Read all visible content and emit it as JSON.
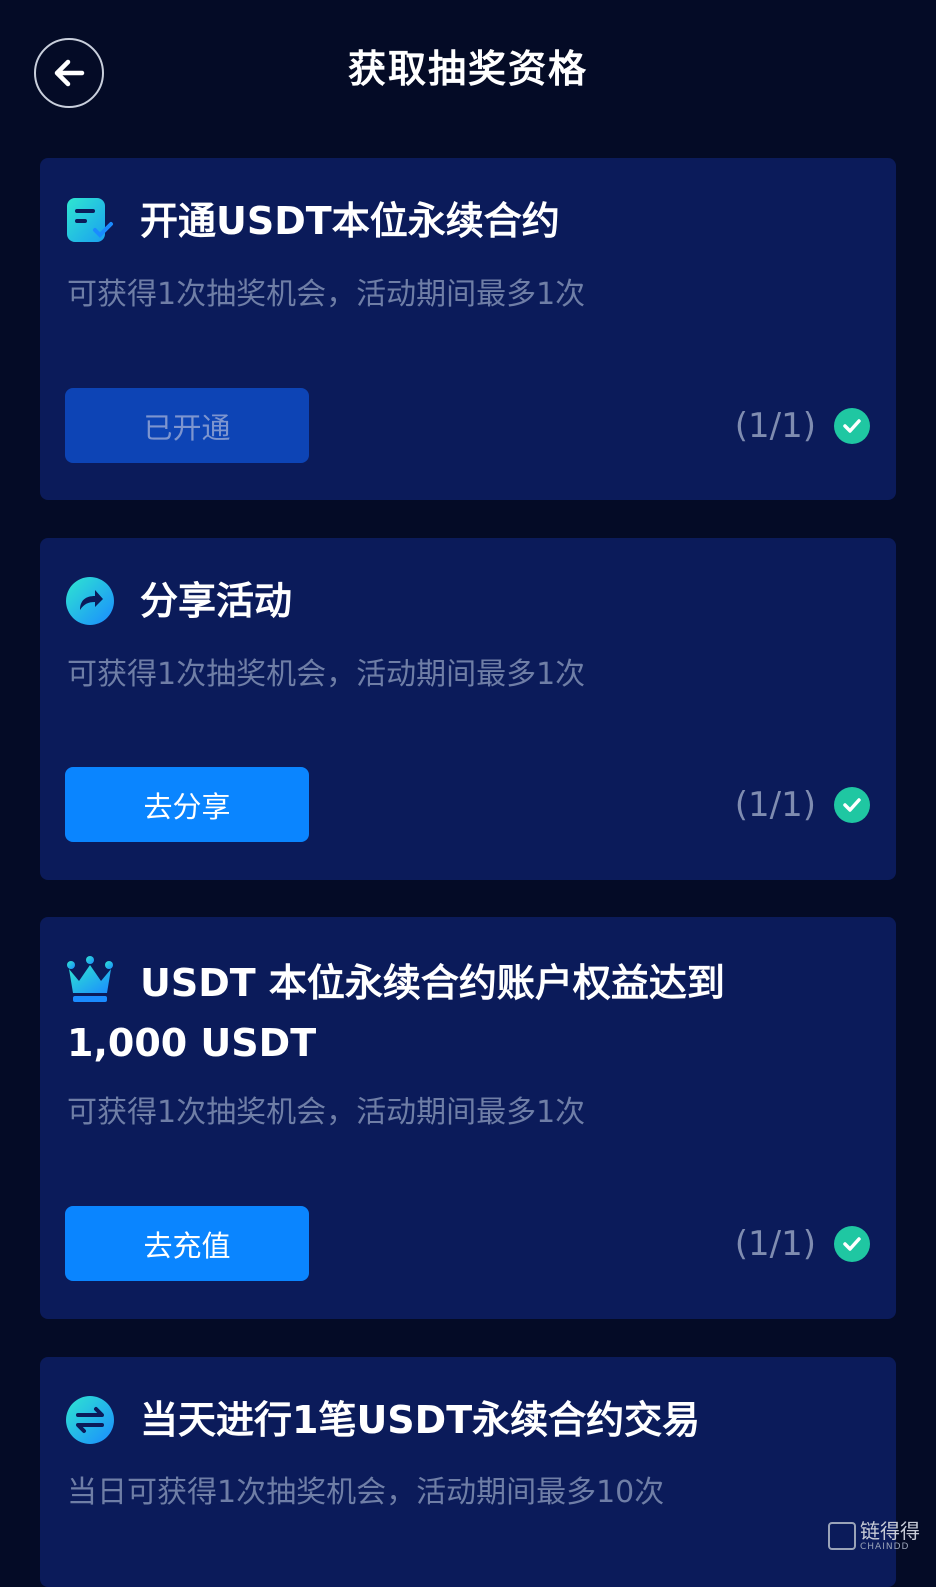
{
  "header": {
    "title": "获取抽奖资格"
  },
  "tasks": [
    {
      "title": "开通USDT本位永续合约",
      "desc": "可获得1次抽奖机会，活动期间最多1次",
      "button": "已开通",
      "progress": "(1/1)",
      "icon": "contract-check-icon"
    },
    {
      "title": "分享活动",
      "desc": "可获得1次抽奖机会，活动期间最多1次",
      "button": "去分享",
      "progress": "(1/1)",
      "icon": "share-icon"
    },
    {
      "title": "USDT 本位永续合约账户权益达到 1,000 USDT",
      "desc": "可获得1次抽奖机会，活动期间最多1次",
      "button": "去充值",
      "progress": "(1/1)",
      "icon": "crown-icon"
    },
    {
      "title": "当天进行1笔USDT永续合约交易",
      "desc": "当日可获得1次抽奖机会，活动期间最多10次",
      "icon": "exchange-icon"
    }
  ],
  "watermark": {
    "text": "链得得",
    "sub": "CHAINDD"
  },
  "colors": {
    "background": "#040b26",
    "card": "#0b1b5a",
    "accent": "#0a85ff",
    "check": "#1fc7a2"
  }
}
